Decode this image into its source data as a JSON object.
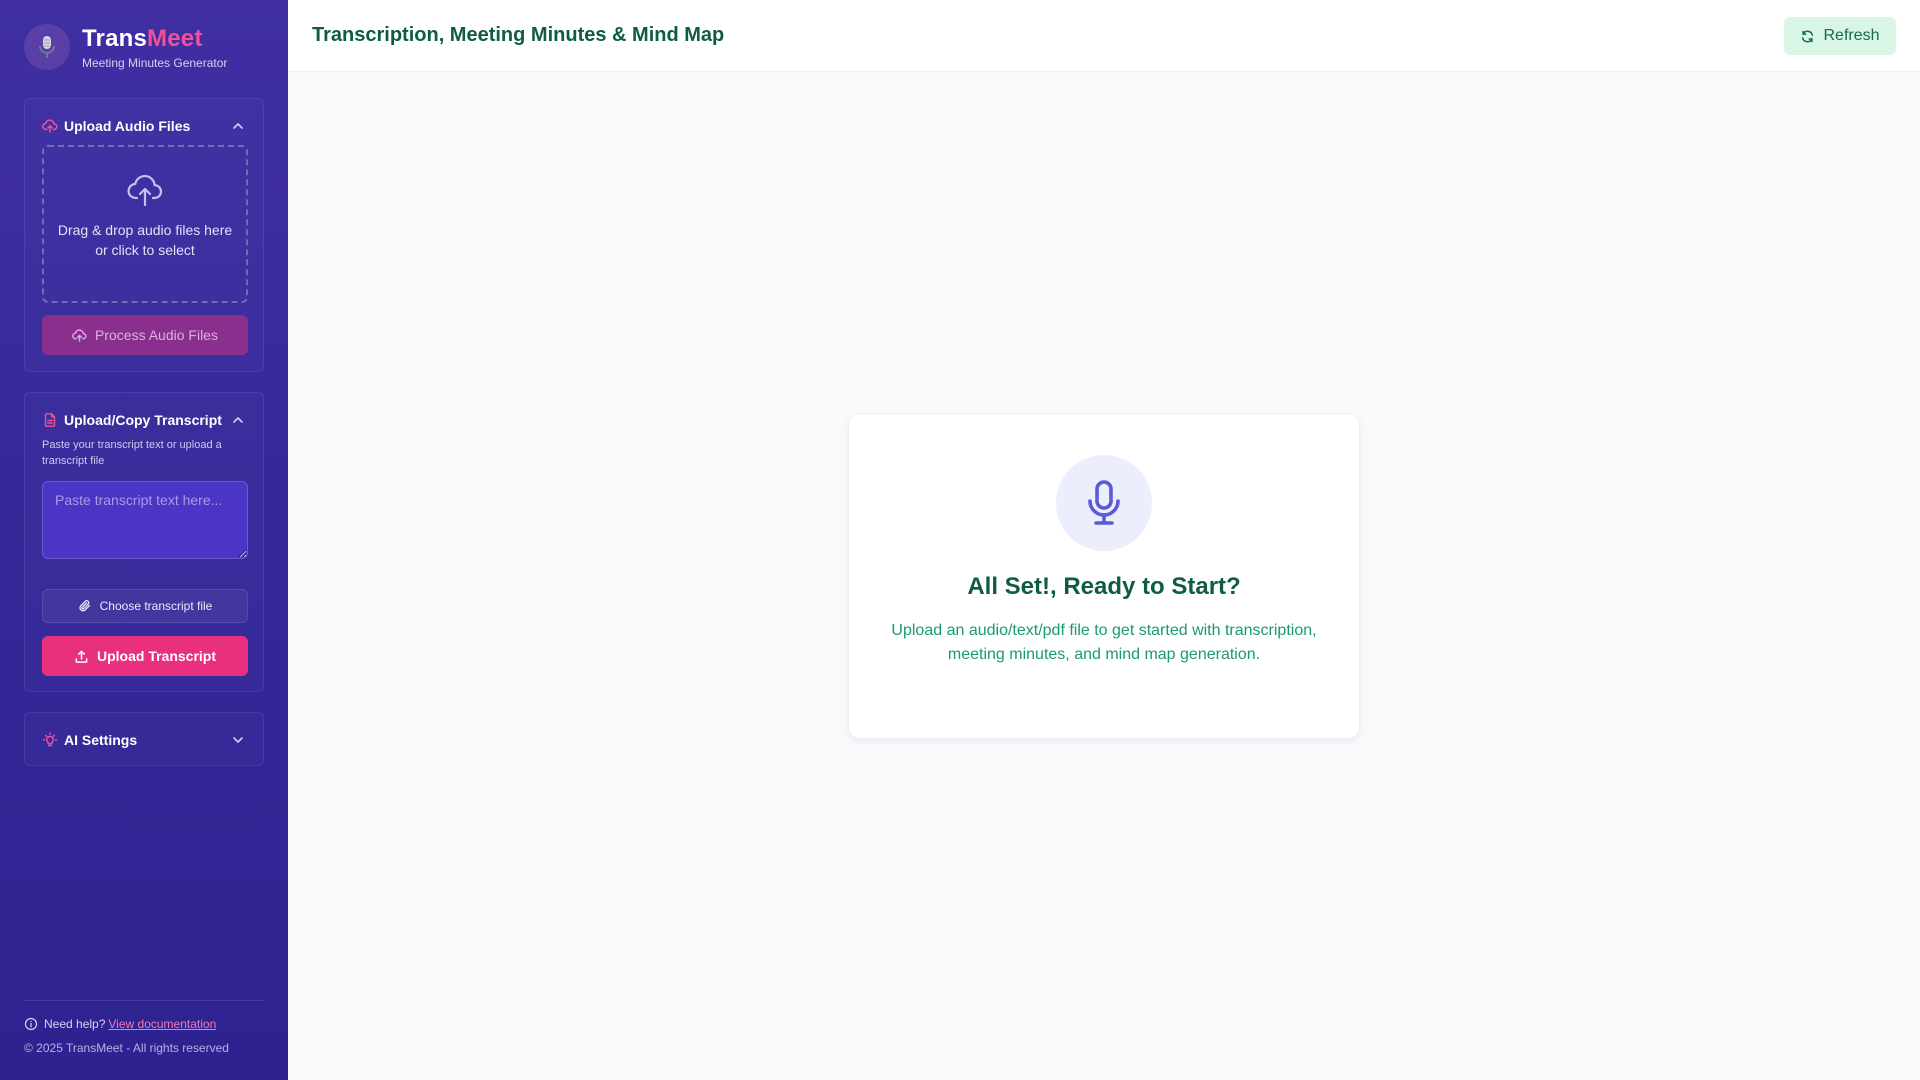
{
  "brand": {
    "title_part_a": "Trans",
    "title_part_b": "Meet",
    "subtitle": "Meeting Minutes Generator",
    "logo_icon": "microphone-icon",
    "accent": "#f0509a"
  },
  "audio_panel": {
    "title": "Upload Audio Files",
    "dropzone_line1": "Drag & drop audio files here",
    "dropzone_line2": "or click to select",
    "process_button": "Process Audio Files",
    "expanded": true
  },
  "transcript_panel": {
    "title": "Upload/Copy Transcript",
    "description": "Paste your transcript text or upload a transcript file",
    "placeholder": "Paste transcript text here...",
    "value": "",
    "choose_file_button": "Choose transcript file",
    "upload_button": "Upload Transcript",
    "expanded": true
  },
  "ai_panel": {
    "title": "AI Settings",
    "expanded": false
  },
  "footer": {
    "help_prefix": "Need help?",
    "help_link": "View documentation",
    "copyright": "© 2025 TransMeet - All rights reserved"
  },
  "header": {
    "title": "Transcription, Meeting Minutes & Mind Map",
    "refresh_button": "Refresh"
  },
  "empty_state": {
    "title": "All Set!, Ready to Start?",
    "text": "Upload an audio/text/pdf file to get started with transcription, meeting minutes, and mind map generation.",
    "icon": "microphone-icon"
  },
  "colors": {
    "sidebar": "#3f2fa3",
    "primary_pink": "#e8307f",
    "heading_green": "#0f5c45",
    "text_green": "#1a9a6e",
    "refresh_bg": "#d8f5e6"
  }
}
